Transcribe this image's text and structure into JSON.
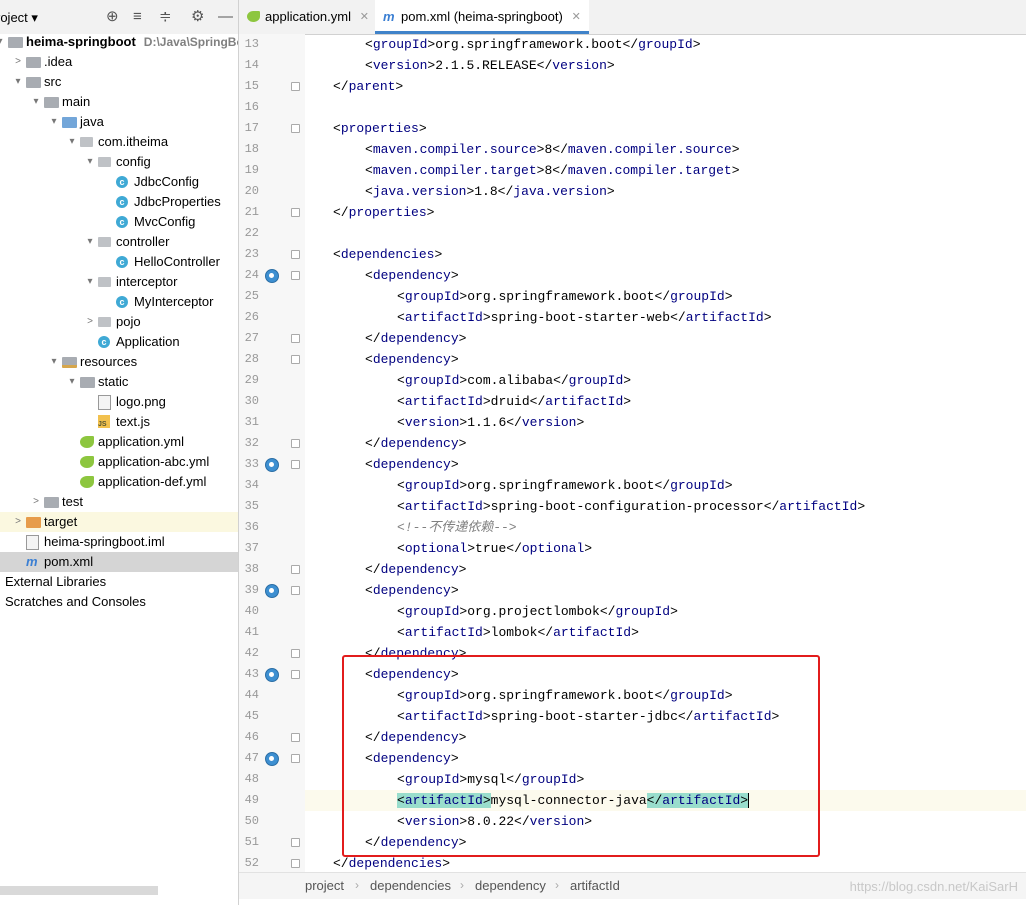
{
  "project": {
    "title": "roject",
    "tools": [
      "⊕",
      "≡",
      "≑",
      "⚙",
      "—"
    ],
    "tree": [
      {
        "label": "heima-springboot",
        "path": "D:\\Java\\SpringBoot\\",
        "icon": "folder-grey",
        "arrow": "▾",
        "depth": 0
      },
      {
        "label": ".idea",
        "icon": "folder-grey",
        "arrow": ">",
        "depth": 1
      },
      {
        "label": "src",
        "icon": "folder-grey",
        "arrow": "▾",
        "depth": 1
      },
      {
        "label": "main",
        "icon": "folder-grey",
        "arrow": "▾",
        "depth": 2
      },
      {
        "label": "java",
        "icon": "folder-blue",
        "arrow": "▾",
        "depth": 3
      },
      {
        "label": "com.itheima",
        "icon": "package",
        "arrow": "▾",
        "depth": 4
      },
      {
        "label": "config",
        "icon": "package",
        "arrow": "▾",
        "depth": 5
      },
      {
        "label": "JdbcConfig",
        "icon": "class",
        "depth": 6
      },
      {
        "label": "JdbcProperties",
        "icon": "class",
        "depth": 6
      },
      {
        "label": "MvcConfig",
        "icon": "class",
        "depth": 6
      },
      {
        "label": "controller",
        "icon": "package",
        "arrow": "▾",
        "depth": 5
      },
      {
        "label": "HelloController",
        "icon": "class",
        "depth": 6
      },
      {
        "label": "interceptor",
        "icon": "package",
        "arrow": "▾",
        "depth": 5
      },
      {
        "label": "MyInterceptor",
        "icon": "class",
        "depth": 6
      },
      {
        "label": "pojo",
        "icon": "package",
        "arrow": ">",
        "depth": 5
      },
      {
        "label": "Application",
        "icon": "class",
        "depth": 5
      },
      {
        "label": "resources",
        "icon": "folder-res",
        "arrow": "▾",
        "depth": 3
      },
      {
        "label": "static",
        "icon": "folder-grey",
        "arrow": "▾",
        "depth": 4
      },
      {
        "label": "logo.png",
        "icon": "file",
        "depth": 5
      },
      {
        "label": "text.js",
        "icon": "js",
        "depth": 5
      },
      {
        "label": "application.yml",
        "icon": "spring",
        "depth": 4
      },
      {
        "label": "application-abc.yml",
        "icon": "spring",
        "depth": 4
      },
      {
        "label": "application-def.yml",
        "icon": "spring",
        "depth": 4
      },
      {
        "label": "test",
        "icon": "folder-grey",
        "arrow": ">",
        "depth": 2
      },
      {
        "label": "target",
        "icon": "folder-orange",
        "arrow": ">",
        "depth": 1
      },
      {
        "label": "heima-springboot.iml",
        "icon": "file",
        "depth": 1
      },
      {
        "label": "pom.xml",
        "icon": "maven",
        "depth": 1
      },
      {
        "label": "External Libraries",
        "icon": "none",
        "depth": 0
      },
      {
        "label": "Scratches and Consoles",
        "icon": "none",
        "depth": 0
      }
    ]
  },
  "tabs": [
    {
      "label": "application.yml",
      "icon": "spring",
      "close": "✕",
      "active": false
    },
    {
      "label": "pom.xml (heima-springboot)",
      "icon": "maven",
      "close": "✕",
      "active": true
    }
  ],
  "editor": {
    "lines": [
      {
        "n": "13",
        "indent": 2,
        "kind": "el",
        "tag": "groupId",
        "value": "org.springframework.boot"
      },
      {
        "n": "14",
        "indent": 2,
        "kind": "el",
        "tag": "version",
        "value": "2.1.5.RELEASE"
      },
      {
        "n": "15",
        "indent": 1,
        "kind": "close",
        "tag": "parent"
      },
      {
        "n": "16",
        "kind": "blank"
      },
      {
        "n": "17",
        "indent": 1,
        "kind": "open",
        "tag": "properties"
      },
      {
        "n": "18",
        "indent": 2,
        "kind": "el",
        "tag": "maven.compiler.source",
        "value": "8"
      },
      {
        "n": "19",
        "indent": 2,
        "kind": "el",
        "tag": "maven.compiler.target",
        "value": "8"
      },
      {
        "n": "20",
        "indent": 2,
        "kind": "el",
        "tag": "java.version",
        "value": "1.8"
      },
      {
        "n": "21",
        "indent": 1,
        "kind": "close",
        "tag": "properties"
      },
      {
        "n": "22",
        "kind": "blank"
      },
      {
        "n": "23",
        "indent": 1,
        "kind": "open",
        "tag": "dependencies"
      },
      {
        "n": "24",
        "indent": 2,
        "kind": "open",
        "tag": "dependency"
      },
      {
        "n": "25",
        "indent": 3,
        "kind": "el",
        "tag": "groupId",
        "value": "org.springframework.boot"
      },
      {
        "n": "26",
        "indent": 3,
        "kind": "el",
        "tag": "artifactId",
        "value": "spring-boot-starter-web"
      },
      {
        "n": "27",
        "indent": 2,
        "kind": "close",
        "tag": "dependency"
      },
      {
        "n": "28",
        "indent": 2,
        "kind": "open",
        "tag": "dependency"
      },
      {
        "n": "29",
        "indent": 3,
        "kind": "el",
        "tag": "groupId",
        "value": "com.alibaba"
      },
      {
        "n": "30",
        "indent": 3,
        "kind": "el",
        "tag": "artifactId",
        "value": "druid"
      },
      {
        "n": "31",
        "indent": 3,
        "kind": "el",
        "tag": "version",
        "value": "1.1.6"
      },
      {
        "n": "32",
        "indent": 2,
        "kind": "close",
        "tag": "dependency"
      },
      {
        "n": "33",
        "indent": 2,
        "kind": "open",
        "tag": "dependency"
      },
      {
        "n": "34",
        "indent": 3,
        "kind": "el",
        "tag": "groupId",
        "value": "org.springframework.boot"
      },
      {
        "n": "35",
        "indent": 3,
        "kind": "el",
        "tag": "artifactId",
        "value": "spring-boot-configuration-processor"
      },
      {
        "n": "36",
        "indent": 3,
        "kind": "comment",
        "value": "<!--不传递依赖-->"
      },
      {
        "n": "37",
        "indent": 3,
        "kind": "el",
        "tag": "optional",
        "value": "true"
      },
      {
        "n": "38",
        "indent": 2,
        "kind": "close",
        "tag": "dependency"
      },
      {
        "n": "39",
        "indent": 2,
        "kind": "open",
        "tag": "dependency"
      },
      {
        "n": "40",
        "indent": 3,
        "kind": "el",
        "tag": "groupId",
        "value": "org.projectlombok"
      },
      {
        "n": "41",
        "indent": 3,
        "kind": "el",
        "tag": "artifactId",
        "value": "lombok"
      },
      {
        "n": "42",
        "indent": 2,
        "kind": "close",
        "tag": "dependency"
      },
      {
        "n": "43",
        "indent": 2,
        "kind": "open",
        "tag": "dependency"
      },
      {
        "n": "44",
        "indent": 3,
        "kind": "el",
        "tag": "groupId",
        "value": "org.springframework.boot"
      },
      {
        "n": "45",
        "indent": 3,
        "kind": "el",
        "tag": "artifactId",
        "value": "spring-boot-starter-jdbc"
      },
      {
        "n": "46",
        "indent": 2,
        "kind": "close",
        "tag": "dependency"
      },
      {
        "n": "47",
        "indent": 2,
        "kind": "open",
        "tag": "dependency"
      },
      {
        "n": "48",
        "indent": 3,
        "kind": "el",
        "tag": "groupId",
        "value": "mysql"
      },
      {
        "n": "49",
        "indent": 3,
        "kind": "el",
        "tag": "artifactId",
        "value": "mysql-connector-java",
        "current": true
      },
      {
        "n": "50",
        "indent": 3,
        "kind": "el",
        "tag": "version",
        "value": "8.0.22"
      },
      {
        "n": "51",
        "indent": 2,
        "kind": "close",
        "tag": "dependency"
      },
      {
        "n": "52",
        "indent": 1,
        "kind": "close",
        "tag": "dependencies"
      }
    ],
    "implement_markers": [
      "24",
      "33",
      "39",
      "43",
      "47"
    ]
  },
  "breadcrumb": [
    "project",
    "dependencies",
    "dependency",
    "artifactId"
  ],
  "watermark": "https://blog.csdn.net/KaiSarH",
  "colors": {
    "tag": "#000080",
    "highlight_box": "#e21c1c",
    "match_highlight": "#99ddcc"
  }
}
